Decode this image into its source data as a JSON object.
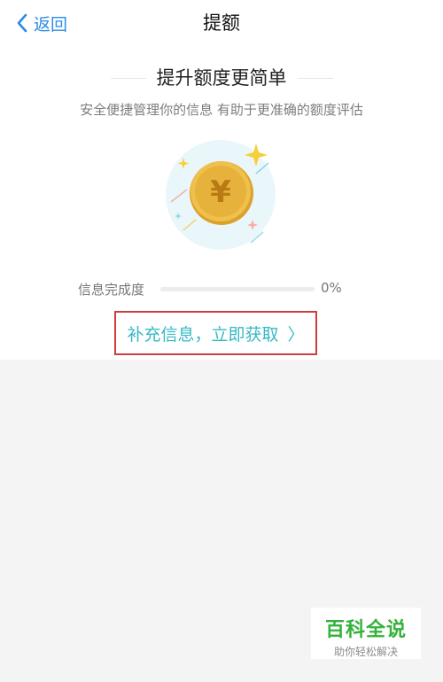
{
  "nav": {
    "back_label": "返回",
    "title": "提额"
  },
  "hero": {
    "headline": "提升额度更简单",
    "subtitle": "安全便捷管理你的信息 有助于更准确的额度评估",
    "coin_symbol": "¥"
  },
  "progress": {
    "label": "信息完成度",
    "value_text": "0%",
    "value_fraction": 0
  },
  "cta": {
    "label": "补充信息，立即获取",
    "chevron": "〉"
  },
  "watermark": {
    "title": "百科全说",
    "subtitle": "助你轻松解决"
  },
  "colors": {
    "accent_blue": "#2a8be6",
    "accent_teal": "#37b9c4",
    "highlight_red": "#c9403d",
    "coin_gold": "#e8b73b",
    "watermark_green": "#34b23a"
  },
  "icons": {
    "back": "chevron-left-icon",
    "coin": "yuan-coin-icon",
    "sparkle": "sparkle-icon",
    "cta": "chevron-right-icon"
  }
}
